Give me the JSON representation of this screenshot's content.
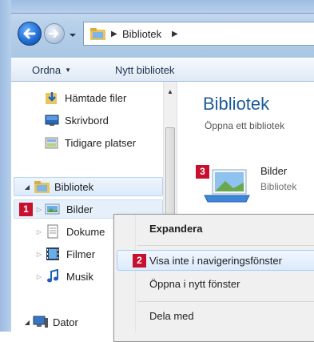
{
  "window": {
    "address": {
      "location": "Bibliotek"
    }
  },
  "toolbar": {
    "organize_label": "Ordna",
    "new_library_label": "Nytt bibliotek"
  },
  "navpane": {
    "favorites": [
      {
        "label": "Hämtade filer",
        "icon": "downloads-folder-icon"
      },
      {
        "label": "Skrivbord",
        "icon": "desktop-icon"
      },
      {
        "label": "Tidigare platser",
        "icon": "recent-places-icon"
      }
    ],
    "libraries_label": "Bibliotek",
    "libraries": [
      {
        "label": "Bilder",
        "icon": "pictures-library-icon"
      },
      {
        "label": "Dokume",
        "icon": "documents-library-icon"
      },
      {
        "label": "Filmer",
        "icon": "videos-library-icon"
      },
      {
        "label": "Musik",
        "icon": "music-library-icon"
      }
    ],
    "computer_label": "Dator"
  },
  "content": {
    "title": "Bibliotek",
    "subtitle": "Öppna ett bibliotek",
    "item": {
      "name": "Bilder",
      "type": "Bibliotek"
    }
  },
  "context_menu": {
    "items": [
      {
        "label": "Expandera"
      },
      {
        "label": "Visa inte i navigeringsfönster"
      },
      {
        "label": "Öppna i nytt fönster"
      },
      {
        "label": "Dela med"
      }
    ]
  },
  "badges": {
    "b1": "1",
    "b2": "2",
    "b3": "3"
  },
  "colors": {
    "badge": "#c8102e",
    "title": "#1e5b9a"
  }
}
